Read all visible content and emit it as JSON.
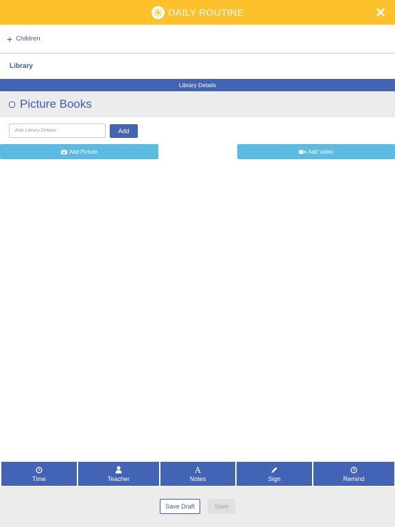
{
  "header": {
    "title": "DAILY ROUTINE",
    "logo_icon": "daily-routine-logo-icon",
    "close_icon": "close-icon",
    "background": "#fdc12c"
  },
  "children": {
    "plus_icon": "+",
    "label": "Children"
  },
  "library": {
    "label": "Library"
  },
  "section": {
    "title": "Library Details"
  },
  "item": {
    "title": "Picture Books"
  },
  "details_input": {
    "value": "",
    "placeholder": "Add Library Details"
  },
  "add_button": {
    "label": "Add"
  },
  "media": {
    "add_picture_label": "Add Picture",
    "add_video_label": "Add Video",
    "picture_icon": "camera-icon",
    "video_icon": "video-camera-icon"
  },
  "tabs": [
    {
      "label": "Time",
      "icon": "clock-icon"
    },
    {
      "label": "Teacher",
      "icon": "person-icon"
    },
    {
      "label": "Notes",
      "icon": "font-a-icon"
    },
    {
      "label": "Sign",
      "icon": "pencil-icon"
    },
    {
      "label": "Remind",
      "icon": "alarm-icon"
    }
  ],
  "footer": {
    "save_draft_label": "Save Draft",
    "save_label": "Save"
  },
  "colors": {
    "primary_blue": "#4363b5",
    "accent_yellow": "#fdc12c",
    "light_blue": "#5bbbe0",
    "panel_gray": "#ececec"
  }
}
